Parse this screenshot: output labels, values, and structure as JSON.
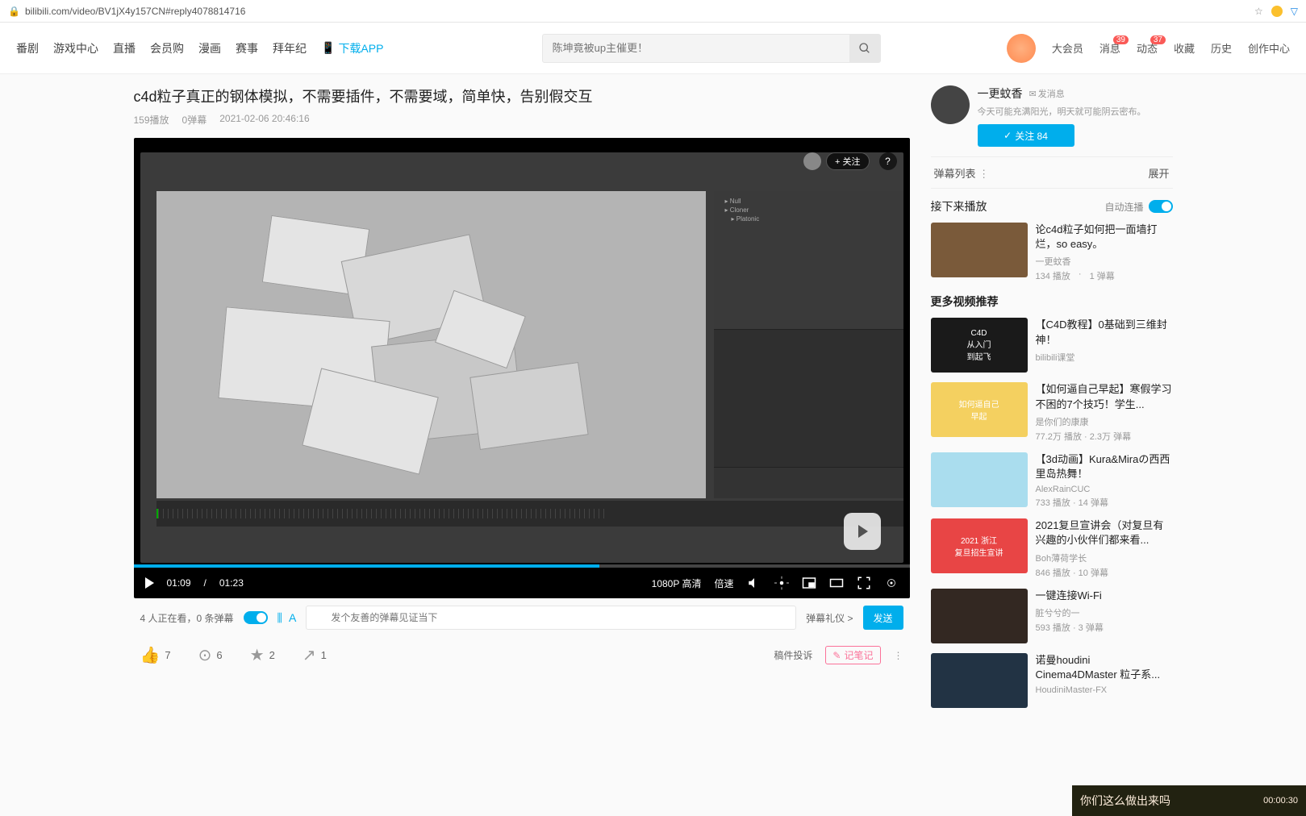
{
  "browser": {
    "url": "bilibili.com/video/BV1jX4y157CN#reply4078814716"
  },
  "nav": {
    "items": [
      "番剧",
      "游戏中心",
      "直播",
      "会员购",
      "漫画",
      "赛事",
      "拜年纪"
    ],
    "download": "下载APP",
    "search_placeholder": "陈坤竟被up主催更！",
    "member": "大会员",
    "message": "消息",
    "message_badge": "39",
    "dynamic": "动态",
    "dynamic_badge": "37",
    "fav": "收藏",
    "history": "历史",
    "creative": "创作中心"
  },
  "video": {
    "title": "c4d粒子真正的钢体模拟，不需要插件，不需要域，简单快，告别假交互",
    "views": "159播放",
    "danmaku": "0弹幕",
    "time": "2021-02-06 20:46:16",
    "follow": "+ 关注",
    "current_time": "01:09",
    "duration": "01:23",
    "quality": "1080P 高清",
    "speed": "倍速"
  },
  "below": {
    "watching": "4 人正在看，0 条弹幕",
    "danmaku_placeholder": "发个友善的弹幕见证当下",
    "gift": "弹幕礼仪 >",
    "send": "发送"
  },
  "actions": {
    "like": "7",
    "coin": "6",
    "fav": "2",
    "share": "1",
    "report": "稿件投诉",
    "note": "记笔记"
  },
  "uploader": {
    "name": "一更蚊香",
    "msg": "发消息",
    "sig": "今天可能充满阳光，明天就可能阴云密布。",
    "follow": "关注 84"
  },
  "danmaku_list": {
    "title": "弹幕列表",
    "expand": "展开"
  },
  "upnext": {
    "title": "接下来播放",
    "autoplay": "自动连播",
    "item": {
      "title": "论c4d粒子如何把一面墙打烂，so easy。",
      "up": "一更蚊香",
      "views": "134 播放",
      "danmaku": "1 弹幕"
    }
  },
  "recs": {
    "heading": "更多视频推荐",
    "items": [
      {
        "thumb": "C4D\n从入门\n到起飞",
        "title": "【C4D教程】0基础到三维封神！",
        "up": "bilibili课堂",
        "views": "",
        "danmaku": "",
        "bg": "#1a1a1a"
      },
      {
        "thumb": "如何逼自己\n早起",
        "title": "【如何逼自己早起】寒假学习不困的7个技巧！学生...",
        "up": "是你们的康康",
        "views": "77.2万 播放",
        "danmaku": "2.3万 弹幕",
        "bg": "#f4d060"
      },
      {
        "thumb": "",
        "title": "【3d动画】Kura&Miraの西西里岛热舞！",
        "up": "AlexRainCUC",
        "views": "733 播放",
        "danmaku": "14 弹幕",
        "bg": "#aaddee"
      },
      {
        "thumb": "2021 浙江\n复旦招生宣讲",
        "title": "2021复旦宣讲会（对复旦有兴趣的小伙伴们都来看...",
        "up": "Boh薄荷学长",
        "views": "846 播放",
        "danmaku": "10 弹幕",
        "bg": "#e84545"
      },
      {
        "thumb": "",
        "title": "一键连接Wi-Fi",
        "up": "脏兮兮的一",
        "views": "593 播放",
        "danmaku": "3 弹幕",
        "bg": "#332822"
      },
      {
        "thumb": "",
        "title": "诺曼houdini Cinema4DMaster 粒子系...",
        "up": "HoudiniMaster-FX",
        "views": "",
        "danmaku": "",
        "bg": "#223344"
      }
    ]
  },
  "floating": {
    "text": "你们这么做出来吗",
    "time": "00:00:30"
  }
}
